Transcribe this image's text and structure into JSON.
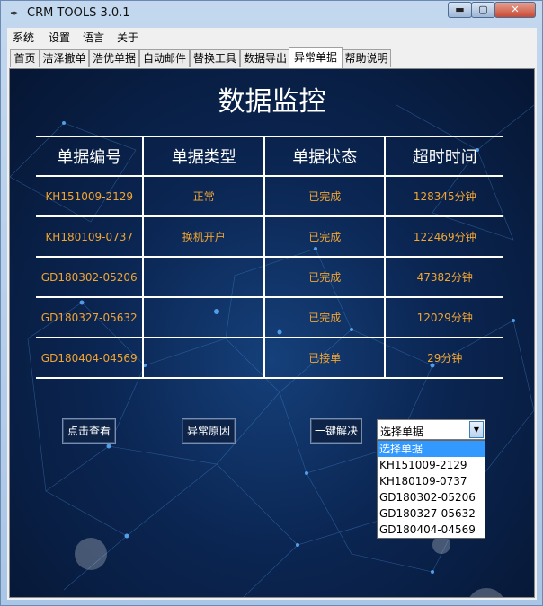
{
  "window": {
    "title": "CRM TOOLS 3.0.1",
    "icon": "feather-icon",
    "controls": {
      "minimize": "▬",
      "maximize": "▢",
      "close": "✕"
    }
  },
  "menu": [
    "系统",
    "设置",
    "语言",
    "关于"
  ],
  "tabs": [
    "首页",
    "洁泽撤单",
    "浩优单据",
    "自动邮件",
    "替换工具",
    "数据导出",
    "异常单据",
    "帮助说明"
  ],
  "active_tab": "异常单据",
  "panel": {
    "heading": "数据监控",
    "columns": [
      "单据编号",
      "单据类型",
      "单据状态",
      "超时时间"
    ],
    "rows": [
      [
        "KH151009-2129",
        "正常",
        "已完成",
        "128345分钟"
      ],
      [
        "KH180109-0737",
        "换机开户",
        "已完成",
        "122469分钟"
      ],
      [
        "GD180302-05206",
        "",
        "已完成",
        "47382分钟"
      ],
      [
        "GD180327-05632",
        "",
        "已完成",
        "12029分钟"
      ],
      [
        "GD180404-04569",
        "",
        "已接单",
        "29分钟"
      ]
    ],
    "buttons": {
      "view": "点击查看",
      "reason": "异常原因",
      "resolve": "一键解决"
    },
    "select": {
      "value": "选择单据",
      "options": [
        "选择单据",
        "KH151009-2129",
        "KH180109-0737",
        "GD180302-05206",
        "GD180327-05632",
        "GD180404-04569"
      ],
      "arrow": "▼"
    },
    "colors": {
      "background": "#0b2653",
      "value_text": "#f2a531",
      "header_text": "#ffffff",
      "selection": "#3399ff"
    }
  }
}
